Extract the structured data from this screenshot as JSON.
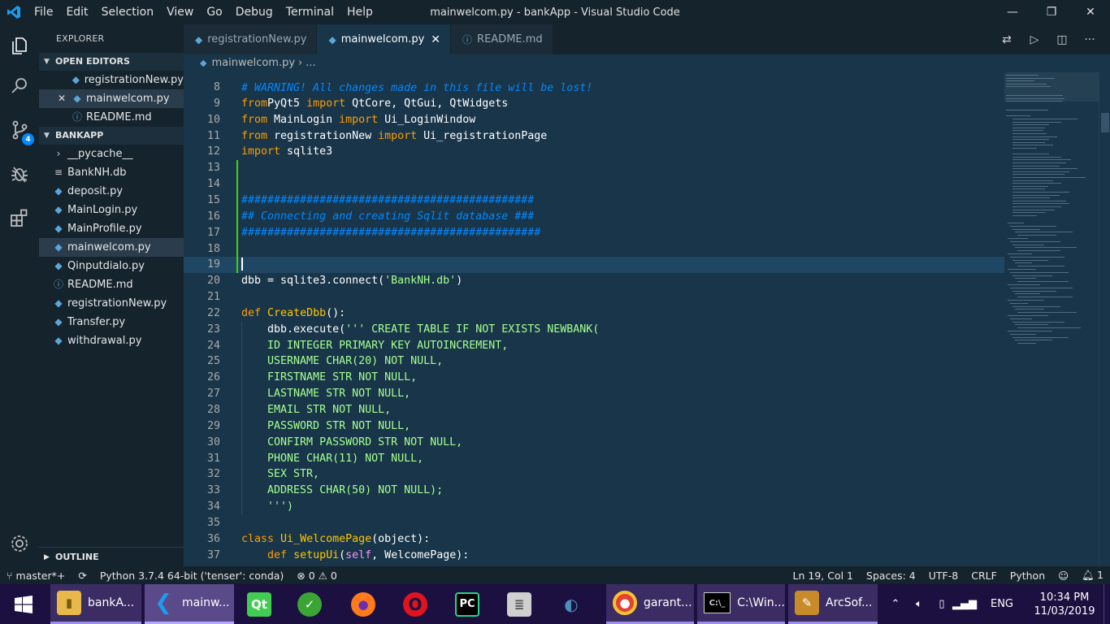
{
  "window": {
    "title": "mainwelcom.py - bankApp - Visual Studio Code",
    "menu": [
      "File",
      "Edit",
      "Selection",
      "View",
      "Go",
      "Debug",
      "Terminal",
      "Help"
    ],
    "controls": [
      "—",
      "❐",
      "✕"
    ]
  },
  "activity": {
    "scm_badge": "4"
  },
  "sidebar": {
    "header": "EXPLORER",
    "open_editors": {
      "label": "OPEN EDITORS",
      "items": [
        {
          "name": "registrationNew.py",
          "type": "py"
        },
        {
          "name": "mainwelcom.py",
          "type": "py",
          "close": "✕"
        },
        {
          "name": "README.md",
          "type": "md"
        }
      ]
    },
    "project": {
      "label": "BANKAPP",
      "items": [
        {
          "name": "__pycache__",
          "type": "folder"
        },
        {
          "name": "BankNH.db",
          "type": "db"
        },
        {
          "name": "deposit.py",
          "type": "py"
        },
        {
          "name": "MainLogin.py",
          "type": "py"
        },
        {
          "name": "MainProfile.py",
          "type": "py"
        },
        {
          "name": "mainwelcom.py",
          "type": "py"
        },
        {
          "name": "Qinputdialo.py",
          "type": "py"
        },
        {
          "name": "README.md",
          "type": "md"
        },
        {
          "name": "registrationNew.py",
          "type": "py"
        },
        {
          "name": "Transfer.py",
          "type": "py"
        },
        {
          "name": "withdrawal.py",
          "type": "py"
        }
      ]
    },
    "outline_label": "OUTLINE"
  },
  "tabs": [
    {
      "label": "registrationNew.py",
      "icon": "python-icon"
    },
    {
      "label": "mainwelcom.py",
      "icon": "python-icon",
      "close": "✕"
    },
    {
      "label": "README.md",
      "icon": "info-icon"
    }
  ],
  "breadcrumb": {
    "file": "mainwelcom.py",
    "sep": "›",
    "rest": "..."
  },
  "editor": {
    "partial_top": "# WARNING! All changes made in this file will be lost!",
    "lines": [
      {
        "n": "8",
        "t": []
      },
      {
        "n": "9",
        "t": [
          [
            "kw",
            "from"
          ],
          [
            "",
            "PyQt5 "
          ],
          [
            "kw",
            "import"
          ],
          [
            "",
            " QtCore, QtGui, QtWidgets"
          ]
        ]
      },
      {
        "n": "10",
        "t": [
          [
            "kw",
            "from"
          ],
          [
            "",
            " MainLogin "
          ],
          [
            "kw",
            "import"
          ],
          [
            "",
            " Ui_LoginWindow"
          ]
        ]
      },
      {
        "n": "11",
        "t": [
          [
            "kw",
            "from"
          ],
          [
            "",
            " registrationNew "
          ],
          [
            "kw",
            "import"
          ],
          [
            "",
            " Ui_registrationPage"
          ]
        ]
      },
      {
        "n": "12",
        "t": [
          [
            "kw",
            "import"
          ],
          [
            "",
            " sqlite3"
          ]
        ]
      },
      {
        "n": "13",
        "t": []
      },
      {
        "n": "14",
        "t": []
      },
      {
        "n": "15",
        "t": [
          [
            "cm",
            "#############################################"
          ]
        ]
      },
      {
        "n": "16",
        "t": [
          [
            "cm",
            "## Connecting and creating Sqlit database ###"
          ]
        ]
      },
      {
        "n": "17",
        "t": [
          [
            "cm",
            "##############################################"
          ]
        ]
      },
      {
        "n": "18",
        "t": []
      },
      {
        "n": "19",
        "t": []
      },
      {
        "n": "20",
        "t": [
          [
            "",
            "dbb = sqlite3.connect("
          ],
          [
            "str",
            "'BankNH.db'"
          ],
          [
            "",
            ")"
          ]
        ]
      },
      {
        "n": "21",
        "t": []
      },
      {
        "n": "22",
        "t": [
          [
            "kw",
            "def"
          ],
          [
            "",
            " "
          ],
          [
            "fn",
            "CreateDbb"
          ],
          [
            "",
            "():"
          ]
        ]
      },
      {
        "n": "23",
        "t": [
          [
            "",
            "    dbb.execute("
          ],
          [
            "str",
            "''' CREATE TABLE IF NOT EXISTS NEWBANK("
          ]
        ]
      },
      {
        "n": "24",
        "t": [
          [
            "str",
            "    ID INTEGER PRIMARY KEY AUTOINCREMENT,"
          ]
        ]
      },
      {
        "n": "25",
        "t": [
          [
            "str",
            "    USERNAME CHAR(20) NOT NULL,"
          ]
        ]
      },
      {
        "n": "26",
        "t": [
          [
            "str",
            "    FIRSTNAME STR NOT NULL,"
          ]
        ]
      },
      {
        "n": "27",
        "t": [
          [
            "str",
            "    LASTNAME STR NOT NULL,"
          ]
        ]
      },
      {
        "n": "28",
        "t": [
          [
            "str",
            "    EMAIL STR NOT NULL,"
          ]
        ]
      },
      {
        "n": "29",
        "t": [
          [
            "str",
            "    PASSWORD STR NOT NULL,"
          ]
        ]
      },
      {
        "n": "30",
        "t": [
          [
            "str",
            "    CONFIRM PASSWORD STR NOT NULL,"
          ]
        ]
      },
      {
        "n": "31",
        "t": [
          [
            "str",
            "    PHONE CHAR(11) NOT NULL,"
          ]
        ]
      },
      {
        "n": "32",
        "t": [
          [
            "str",
            "    SEX STR,"
          ]
        ]
      },
      {
        "n": "33",
        "t": [
          [
            "str",
            "    ADDRESS CHAR(50) NOT NULL);"
          ]
        ]
      },
      {
        "n": "34",
        "t": [
          [
            "str",
            "    ''')"
          ]
        ]
      },
      {
        "n": "35",
        "t": []
      },
      {
        "n": "36",
        "t": [
          [
            "kw",
            "class"
          ],
          [
            "",
            " "
          ],
          [
            "cls",
            "Ui_WelcomePage"
          ],
          [
            "",
            "(object):"
          ]
        ]
      },
      {
        "n": "37",
        "t": [
          [
            "",
            "    "
          ],
          [
            "kw",
            "def"
          ],
          [
            "",
            " "
          ],
          [
            "fn",
            "setupUi"
          ],
          [
            "",
            "("
          ],
          [
            "self",
            "self"
          ],
          [
            "",
            ", WelcomePage):"
          ]
        ]
      }
    ],
    "current_line": "19"
  },
  "status": {
    "branch": "master*+",
    "python": "Python 3.7.4 64-bit ('tenser': conda)",
    "errors": "⊗ 0 ⚠ 0",
    "position": "Ln 19, Col 1",
    "spaces": "Spaces: 4",
    "encoding": "UTF-8",
    "eol": "CRLF",
    "language": "Python",
    "bell": "1"
  },
  "taskbar": {
    "apps": [
      {
        "label": "bankA...",
        "icon": "folder-icon"
      },
      {
        "label": "mainw...",
        "icon": "vscode-icon"
      },
      {
        "label": "",
        "icon": "qt-icon"
      },
      {
        "label": "",
        "icon": "check-icon"
      },
      {
        "label": "",
        "icon": "firefox-icon"
      },
      {
        "label": "",
        "icon": "opera-icon"
      },
      {
        "label": "",
        "icon": "pycharm-icon"
      },
      {
        "label": "",
        "icon": "database-icon"
      },
      {
        "label": "",
        "icon": "mysql-icon"
      },
      {
        "label": "garant...",
        "icon": "chrome-icon"
      },
      {
        "label": "C:\\Win...",
        "icon": "cmd-icon"
      },
      {
        "label": "ArcSof...",
        "icon": "arcsoft-icon"
      }
    ],
    "lang": "ENG",
    "time": "10:34 PM",
    "date": "11/03/2019"
  },
  "colors": {
    "editor_bg": "#193549",
    "sidebar_bg": "#15232d",
    "keyword": "#ff9d00",
    "string": "#a5ff90",
    "comment": "#0088ff"
  }
}
